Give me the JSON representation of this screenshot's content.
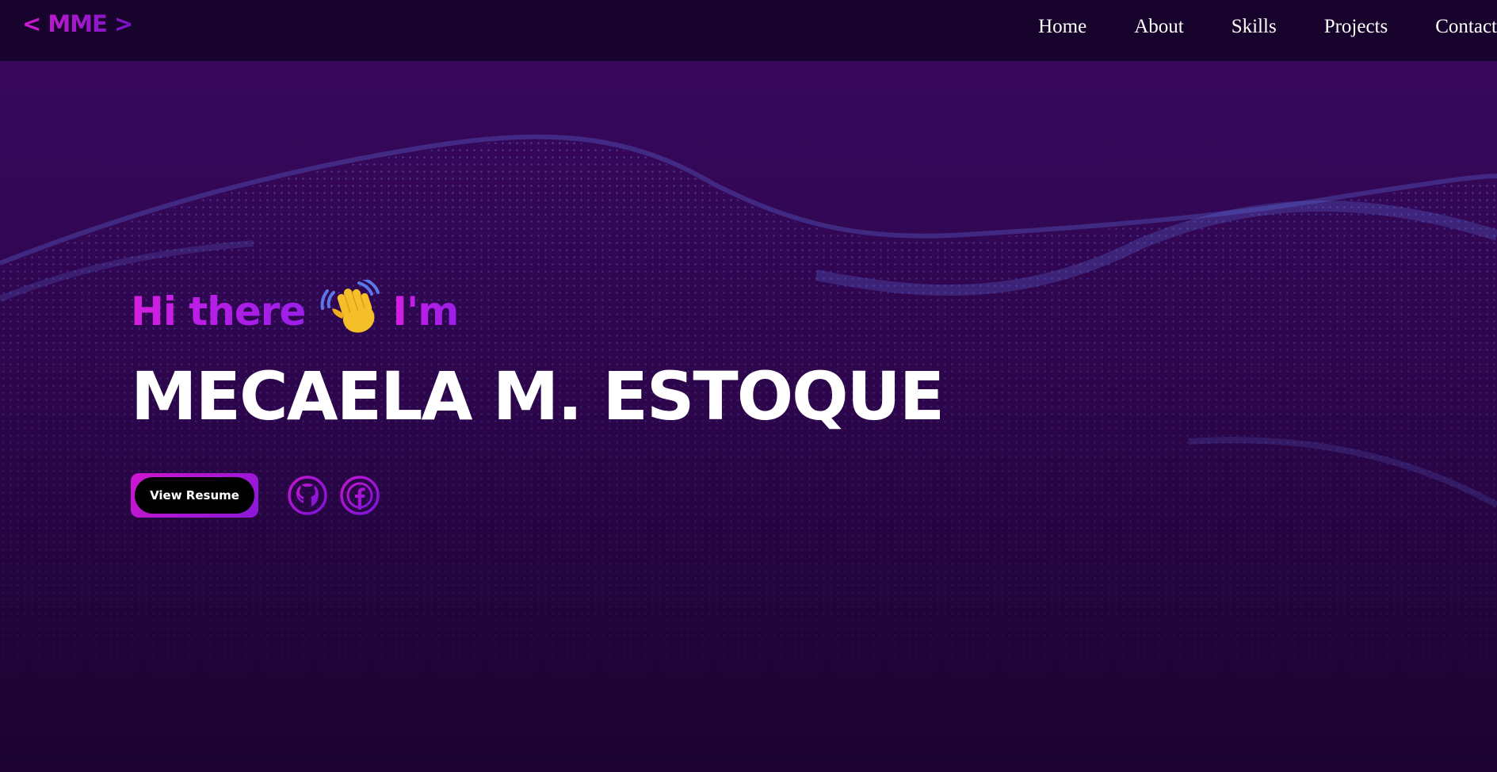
{
  "nav": {
    "logo": "< MME >",
    "links": [
      "Home",
      "About",
      "Skills",
      "Projects",
      "Contact"
    ]
  },
  "hero": {
    "greeting_prefix": "Hi there",
    "greeting_suffix": "I'm",
    "name": "MECAELA M. ESTOQUE",
    "resume_label": "View Resume"
  },
  "icons": {
    "wave": "waving-hand-icon",
    "github": "github-icon",
    "facebook": "facebook-icon"
  },
  "colors": {
    "navbar_bg": "#17032b",
    "hero_bg": "#330756",
    "accent_pink": "#d11bd1",
    "accent_purple": "#8a18d8",
    "text_white": "#ffffff",
    "dot_blue": "#5b6cd8"
  }
}
